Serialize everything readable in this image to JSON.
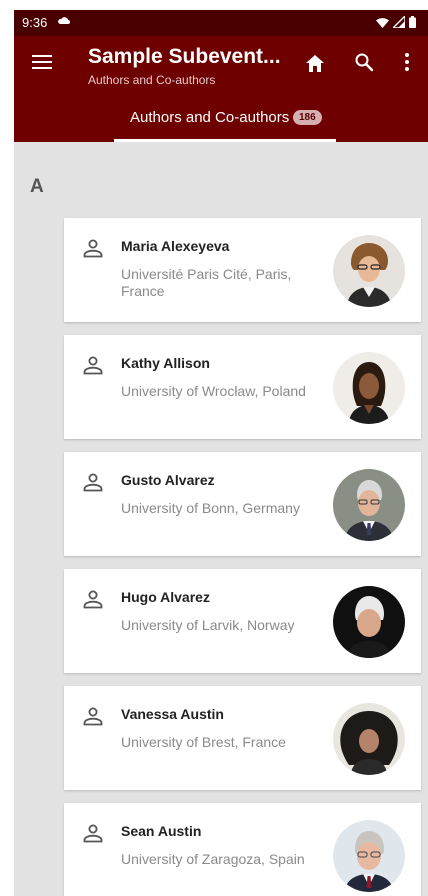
{
  "status_bar": {
    "time": "9:36"
  },
  "app_bar": {
    "title": "Sample Subevent...",
    "subtitle": "Authors and Co-authors"
  },
  "tab": {
    "label": "Authors and Co-authors",
    "count": "186"
  },
  "section_letter": "A",
  "colors": {
    "primary": "#6e0000",
    "status_bar": "#4a0000",
    "background": "#e2e2e2",
    "badge": "#d6b0b0"
  },
  "authors": [
    {
      "name": "Maria Alexeyeva",
      "affiliation": "Université Paris Cité, Paris, France"
    },
    {
      "name": "Kathy Allison",
      "affiliation": "University of Wrocław, Poland"
    },
    {
      "name": "Gusto Alvarez",
      "affiliation": "University of Bonn, Germany"
    },
    {
      "name": "Hugo Alvarez",
      "affiliation": "University of Larvik, Norway"
    },
    {
      "name": "Vanessa Austin",
      "affiliation": "University of Brest, France"
    },
    {
      "name": "Sean Austin",
      "affiliation": "University of Zaragoza, Spain"
    }
  ]
}
